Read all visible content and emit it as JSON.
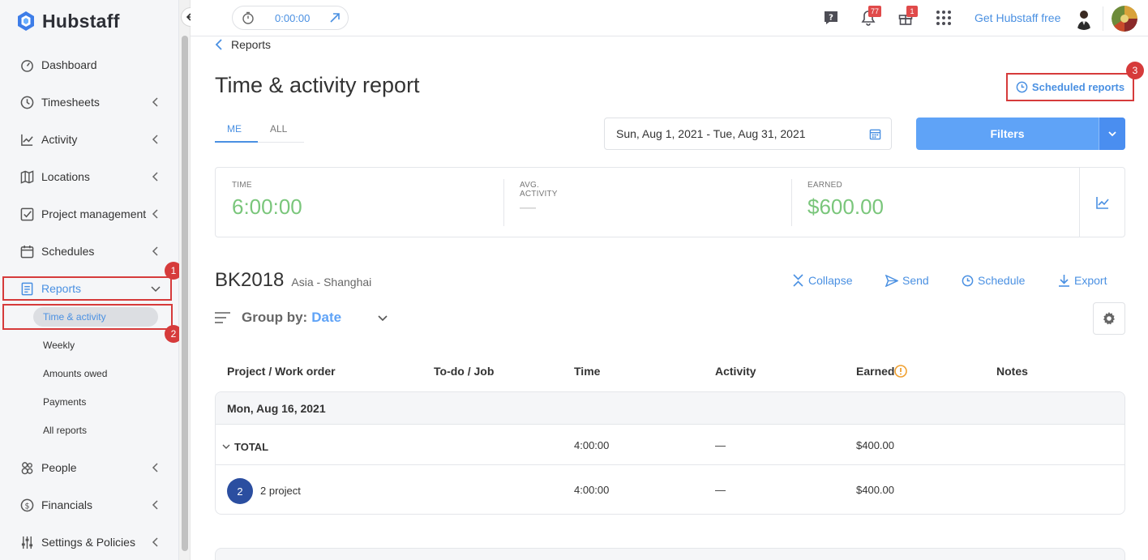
{
  "brand": {
    "name": "Hubstaff"
  },
  "sidebar": {
    "items": [
      {
        "label": "Dashboard",
        "icon": "dashboard-icon"
      },
      {
        "label": "Timesheets",
        "icon": "clock-icon"
      },
      {
        "label": "Activity",
        "icon": "activity-chart-icon"
      },
      {
        "label": "Locations",
        "icon": "map-icon"
      },
      {
        "label": "Project management",
        "icon": "checkbox-icon"
      },
      {
        "label": "Schedules",
        "icon": "calendar-icon"
      },
      {
        "label": "Reports",
        "icon": "report-icon"
      },
      {
        "label": "People",
        "icon": "people-icon"
      },
      {
        "label": "Financials",
        "icon": "dollar-icon"
      },
      {
        "label": "Settings & Policies",
        "icon": "sliders-icon"
      }
    ],
    "reports_sub": [
      "Time & activity",
      "Weekly",
      "Amounts owed",
      "Payments",
      "All reports"
    ]
  },
  "annotations": {
    "one": "1",
    "two": "2",
    "three": "3"
  },
  "topbar": {
    "timer": "0:00:00",
    "notifications_count": "77",
    "gifts_count": "1",
    "get_free": "Get Hubstaff free"
  },
  "page": {
    "back": "Reports",
    "title": "Time & activity report",
    "scheduled_reports": "Scheduled reports",
    "tabs": [
      "ME",
      "ALL"
    ],
    "date_range": "Sun, Aug 1, 2021 - Tue, Aug 31, 2021",
    "filters": "Filters"
  },
  "stats": {
    "time_label": "TIME",
    "time_value": "6:00:00",
    "activity_label": "AVG. ACTIVITY",
    "activity_value": "—",
    "earned_label": "EARNED",
    "earned_value": "$600.00"
  },
  "member": {
    "name": "BK2018",
    "timezone": "Asia - Shanghai",
    "actions": [
      "Collapse",
      "Send",
      "Schedule",
      "Export"
    ],
    "group_by_label": "Group by:",
    "group_by_value": "Date"
  },
  "table": {
    "headers": [
      "Project / Work order",
      "To-do / Job",
      "Time",
      "Activity",
      "Earned",
      "Notes"
    ],
    "date": "Mon, Aug 16, 2021",
    "total": {
      "label": "TOTAL",
      "time": "4:00:00",
      "activity": "—",
      "earned": "$400.00"
    },
    "rows": [
      {
        "badge": "2",
        "project": "2 project",
        "time": "4:00:00",
        "activity": "—",
        "earned": "$400.00"
      }
    ]
  },
  "colors": {
    "accent": "#4a90e2",
    "green": "#7ac67b",
    "annotation": "#d63b3b",
    "filters": "#5fa3f7"
  }
}
